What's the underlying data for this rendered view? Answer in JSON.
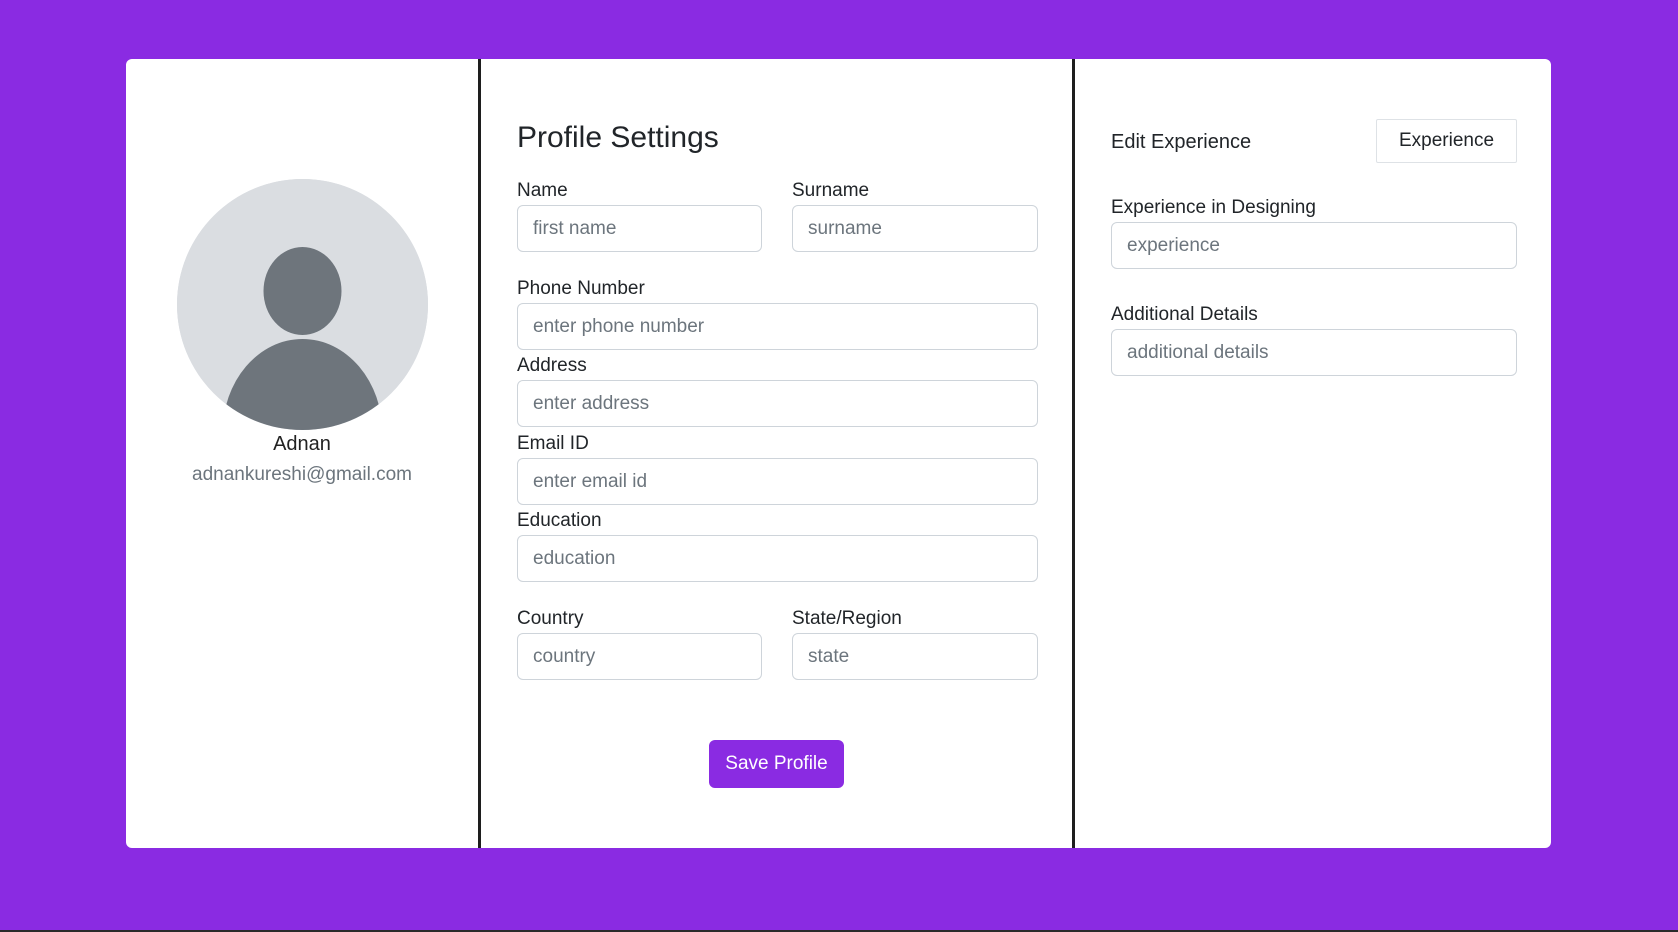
{
  "colors": {
    "background": "#8a2be2",
    "accent": "#8a2be2",
    "card": "#ffffff"
  },
  "profile": {
    "avatar_icon": "user-avatar-icon",
    "name": "Adnan",
    "email": "adnankureshi@gmail.com"
  },
  "form": {
    "title": "Profile Settings",
    "fields": {
      "name": {
        "label": "Name",
        "placeholder": "first name",
        "value": ""
      },
      "surname": {
        "label": "Surname",
        "placeholder": "surname",
        "value": ""
      },
      "phone": {
        "label": "Phone Number",
        "placeholder": "enter phone number",
        "value": ""
      },
      "address": {
        "label": "Address",
        "placeholder": "enter address",
        "value": ""
      },
      "email": {
        "label": "Email ID",
        "placeholder": "enter email id",
        "value": ""
      },
      "education": {
        "label": "Education",
        "placeholder": "education",
        "value": ""
      },
      "country": {
        "label": "Country",
        "placeholder": "country",
        "value": ""
      },
      "state": {
        "label": "State/Region",
        "placeholder": "state",
        "value": ""
      }
    },
    "save_label": "Save Profile"
  },
  "experience": {
    "heading": "Edit Experience",
    "button_label": "Experience",
    "fields": {
      "designing": {
        "label": "Experience in Designing",
        "placeholder": "experience",
        "value": ""
      },
      "additional": {
        "label": "Additional Details",
        "placeholder": "additional details",
        "value": ""
      }
    }
  }
}
